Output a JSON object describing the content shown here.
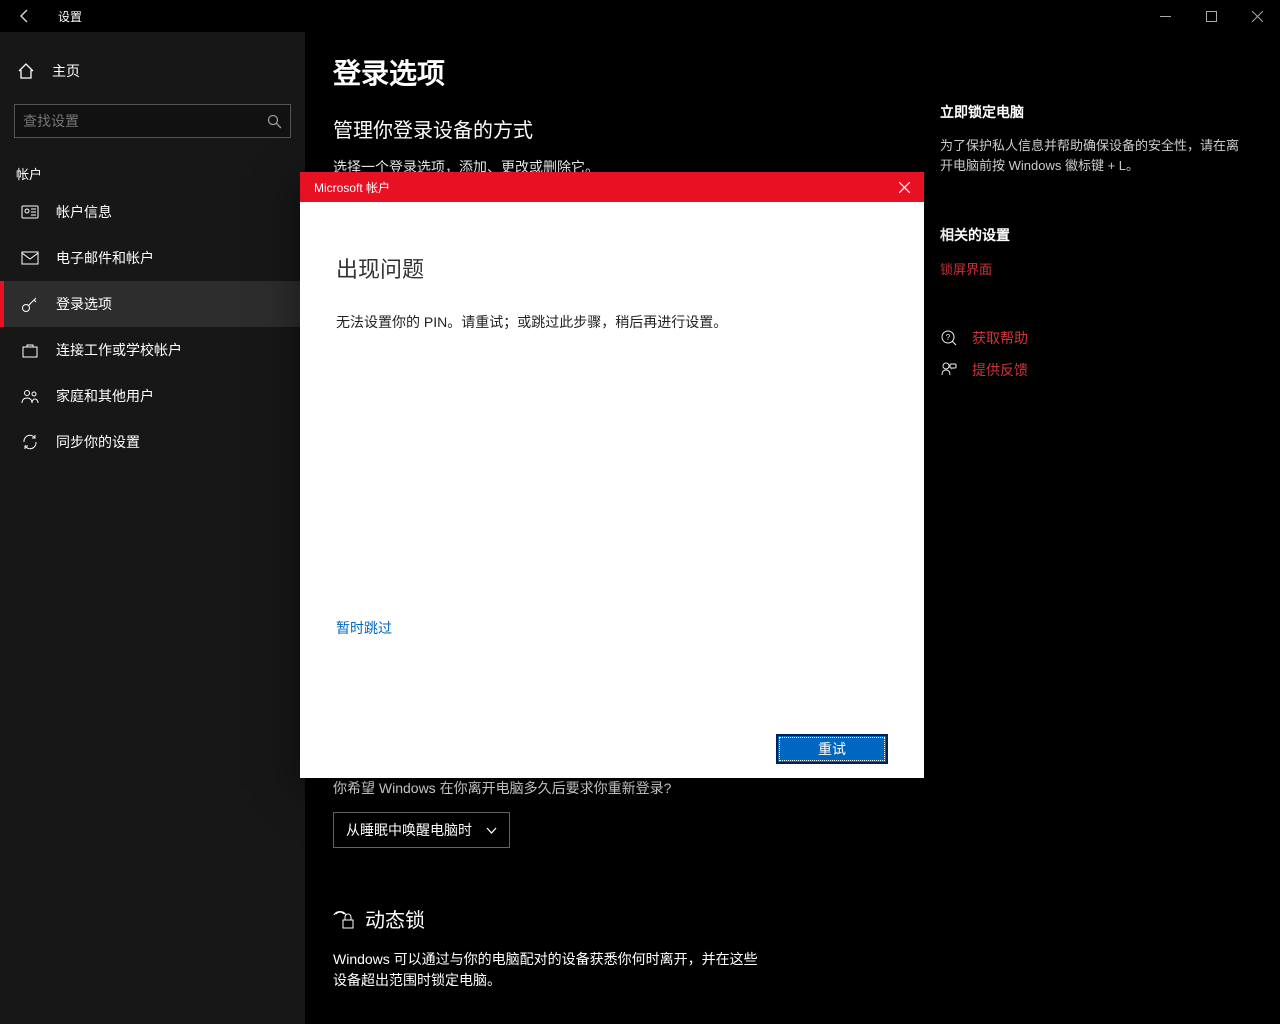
{
  "window": {
    "title": "设置"
  },
  "sidebar": {
    "home": "主页",
    "search_placeholder": "查找设置",
    "section": "帐户",
    "items": [
      {
        "label": "帐户信息"
      },
      {
        "label": "电子邮件和帐户"
      },
      {
        "label": "登录选项"
      },
      {
        "label": "连接工作或学校帐户"
      },
      {
        "label": "家庭和其他用户"
      },
      {
        "label": "同步你的设置"
      }
    ]
  },
  "main": {
    "page_title": "登录选项",
    "manage_heading": "管理你登录设备的方式",
    "manage_text": "选择一个登录选项，添加、更改或删除它。",
    "relogin_prompt": "你希望 Windows 在你离开电脑多久后要求你重新登录?",
    "relogin_dropdown": "从睡眠中唤醒电脑时",
    "dynamic_lock_title": "动态锁",
    "dynamic_lock_text": "Windows 可以通过与你的电脑配对的设备获悉你何时离开，并在这些设备超出范围时锁定电脑。"
  },
  "aside": {
    "lock_heading": "立即锁定电脑",
    "lock_text": "为了保护私人信息并帮助确保设备的安全性，请在离开电脑前按 Windows 徽标键 + L。",
    "related_heading": "相关的设置",
    "related_link": "锁屏界面",
    "help": "获取帮助",
    "feedback": "提供反馈"
  },
  "dialog": {
    "header": "Microsoft 帐户",
    "title": "出现问题",
    "body": "无法设置你的 PIN。请重试；或跳过此步骤，稍后再进行设置。",
    "skip": "暂时跳过",
    "retry": "重试"
  }
}
